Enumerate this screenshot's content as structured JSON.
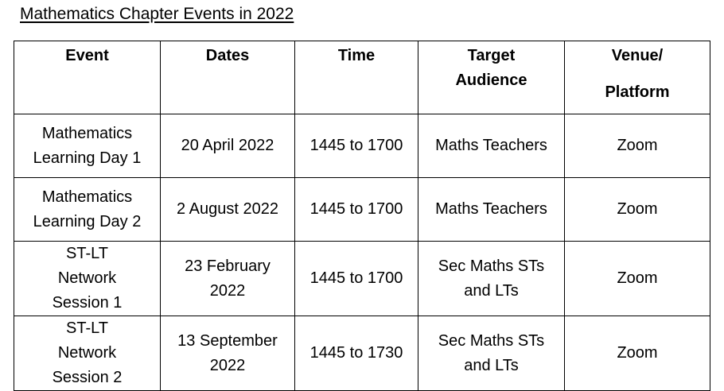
{
  "document": {
    "title": "Mathematics Chapter Events in 2022"
  },
  "table": {
    "headers": {
      "event": "Event",
      "dates": "Dates",
      "time": "Time",
      "target": "Target Audience",
      "venue_line1": "Venue/",
      "venue_line2": "Platform"
    },
    "rows": [
      {
        "event": "Mathematics Learning Day 1",
        "dates": "20 April 2022",
        "time": "1445 to 1700",
        "target": "Maths Teachers",
        "venue": "Zoom"
      },
      {
        "event": "Mathematics Learning Day 2",
        "dates": "2 August 2022",
        "time": "1445 to 1700",
        "target": "Maths Teachers",
        "venue": "Zoom"
      },
      {
        "event": "ST-LT Network Session 1",
        "dates": "23 February 2022",
        "time": "1445 to 1700",
        "target": "Sec Maths STs and LTs",
        "venue": "Zoom"
      },
      {
        "event": "ST-LT Network Session 2",
        "dates": "13 September 2022",
        "time": "1445 to 1730",
        "target": "Sec Maths STs and LTs",
        "venue": "Zoom"
      }
    ]
  }
}
